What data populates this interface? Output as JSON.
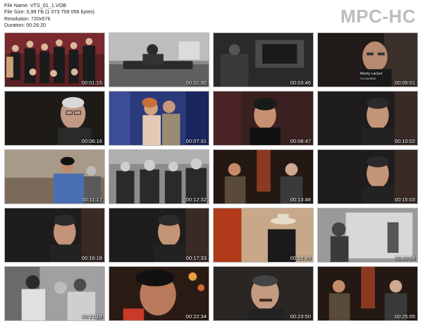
{
  "file_info": {
    "name": "File Name: VTS_01_1.VOB",
    "size": "File Size: 0,99 ГБ (1 073 709 056 bytes)",
    "resolution": "Resolution: 720x576",
    "duration": "Duration: 00:26:20"
  },
  "logo": "MPC-HC",
  "thumbnails": [
    {
      "time": "00:01:15",
      "icon": "group-photo"
    },
    {
      "time": "00:02:30",
      "icon": "bw-piano-scene"
    },
    {
      "time": "00:03:46",
      "icon": "dark-scene"
    },
    {
      "time": "00:05:01",
      "icon": "interview-portrait",
      "caption": "Marty Lacker",
      "caption_sub": "Accountant"
    },
    {
      "time": "00:06:16",
      "icon": "interview-portrait"
    },
    {
      "time": "00:07:31",
      "icon": "couple-scene"
    },
    {
      "time": "00:08:47",
      "icon": "performer-portrait"
    },
    {
      "time": "00:10:02",
      "icon": "interview-portrait"
    },
    {
      "time": "00:11:17",
      "icon": "stage-performance"
    },
    {
      "time": "00:12:32",
      "icon": "bw-crowd-scene"
    },
    {
      "time": "00:13:48",
      "icon": "two-men-seated"
    },
    {
      "time": "00:15:03",
      "icon": "interview-portrait"
    },
    {
      "time": "00:16:18",
      "icon": "interview-portrait"
    },
    {
      "time": "00:17:33",
      "icon": "interview-portrait"
    },
    {
      "time": "00:18:49",
      "icon": "cowboy-hat-scene"
    },
    {
      "time": "00:20:04",
      "icon": "bw-room-scene"
    },
    {
      "time": "00:21:19",
      "icon": "bw-group-scene"
    },
    {
      "time": "00:22:34",
      "icon": "closeup-portrait"
    },
    {
      "time": "00:23:50",
      "icon": "interview-portrait"
    },
    {
      "time": "00:25:05",
      "icon": "two-men-seated"
    }
  ]
}
